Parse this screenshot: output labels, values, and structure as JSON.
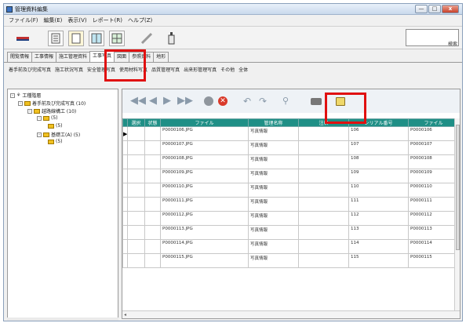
{
  "window": {
    "title": "管理資料編集",
    "min": "—",
    "max": "□",
    "close": "x"
  },
  "menu": [
    "ファイル(F)",
    "編集(E)",
    "表示(V)",
    "レポート(R)",
    "ヘルプ(Z)"
  ],
  "search": {
    "button": "検索"
  },
  "tabs": [
    "閲覧情報",
    "工事情報",
    "施工管理資料",
    "工事写真",
    "図面",
    "参照資料",
    "地形"
  ],
  "subtabs": [
    "着手前及び完成写真",
    "施工状況写真",
    "安全管理写真",
    "使用材料写真",
    "品質管理写真",
    "出来形管理写真",
    "その他",
    "全体"
  ],
  "tree": [
    {
      "label": "工種階層",
      "expander": "-"
    },
    {
      "label": "着手前及び完成写真 (10)",
      "expander": "-"
    },
    {
      "label": "越路線構工 (10)",
      "expander": "-"
    },
    {
      "label": "(5)",
      "expander": "-"
    },
    {
      "label": "(5)",
      "expander": ""
    },
    {
      "label": "基礎工(A) (5)",
      "expander": "-"
    },
    {
      "label": "(5)",
      "expander": ""
    }
  ],
  "grid": {
    "columns": [
      "",
      "選択",
      "状態",
      "ファイル",
      "管理名称",
      "注釈",
      "シリアル番号",
      "ファイル"
    ],
    "rows": [
      {
        "file": "P0000106.JPG",
        "name": "写真情報",
        "serial": "106",
        "file2": "P0000106"
      },
      {
        "file": "P0000107.JPG",
        "name": "写真情報",
        "serial": "107",
        "file2": "P0000107"
      },
      {
        "file": "P0000108.JPG",
        "name": "写真情報",
        "serial": "108",
        "file2": "P0000108"
      },
      {
        "file": "P0000109.JPG",
        "name": "写真情報",
        "serial": "109",
        "file2": "P0000109"
      },
      {
        "file": "P0000110.JPG",
        "name": "写真情報",
        "serial": "110",
        "file2": "P0000110"
      },
      {
        "file": "P0000111.JPG",
        "name": "写真情報",
        "serial": "111",
        "file2": "P0000111"
      },
      {
        "file": "P0000112.JPG",
        "name": "写真情報",
        "serial": "112",
        "file2": "P0000112"
      },
      {
        "file": "P0000113.JPG",
        "name": "写真情報",
        "serial": "113",
        "file2": "P0000113"
      },
      {
        "file": "P0000114.JPG",
        "name": "写真情報",
        "serial": "114",
        "file2": "P0000114"
      },
      {
        "file": "P0000115.JPG",
        "name": "写真情報",
        "serial": "115",
        "file2": "P0000115"
      }
    ],
    "current_row_marker": "▶"
  },
  "colors": {
    "grid_header": "#1f8f86",
    "highlight": "#e01010"
  },
  "icons": [
    "first-icon",
    "prev-icon",
    "next-icon",
    "last-icon",
    "stop-icon",
    "delete-icon",
    "undo-icon",
    "redo-icon",
    "zoom-icon",
    "camera-icon",
    "edit-photo-icon"
  ]
}
